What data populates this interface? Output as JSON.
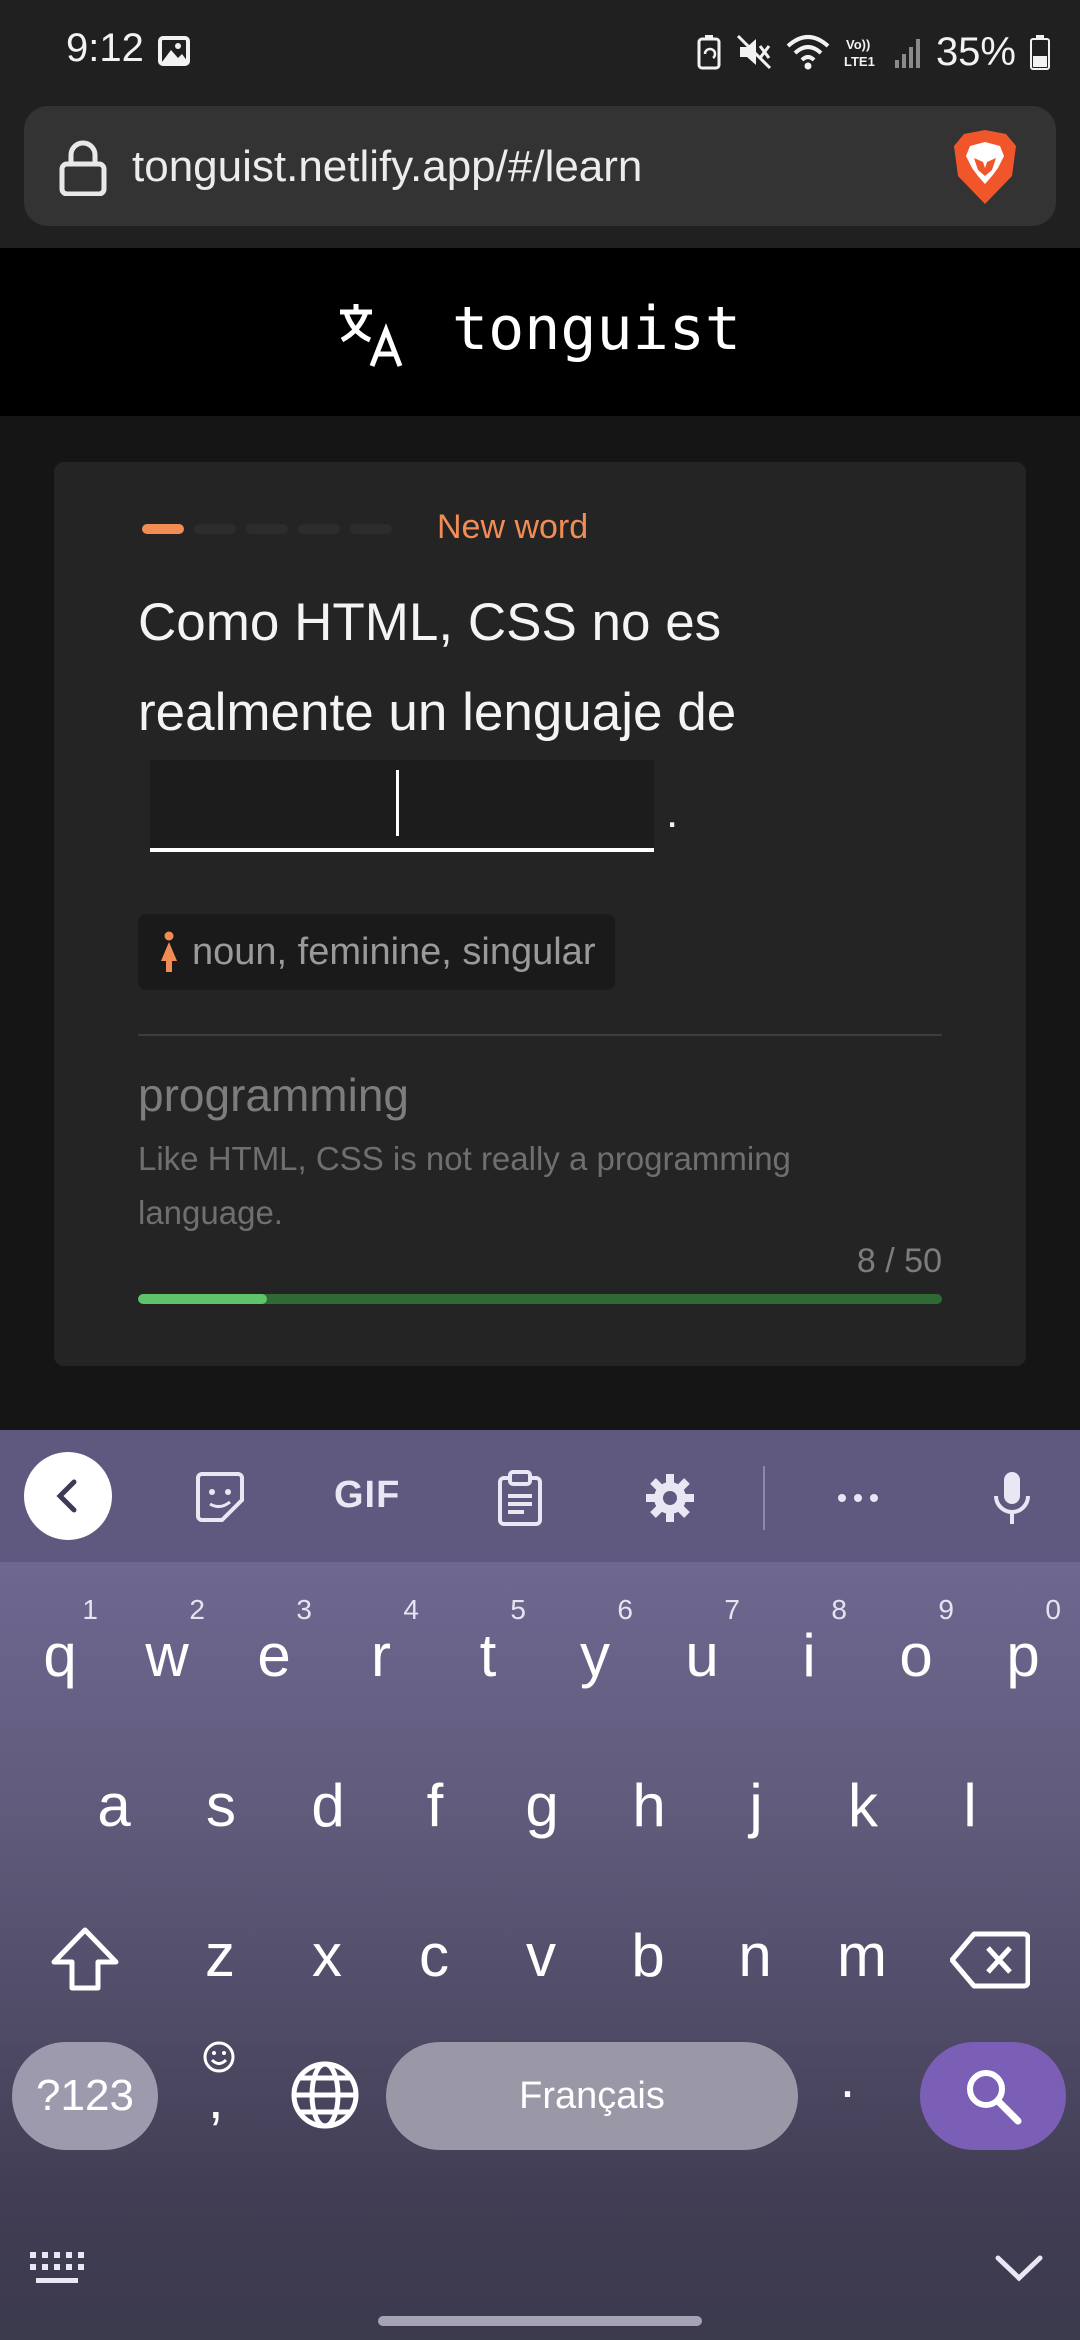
{
  "status_bar": {
    "time": "9:12",
    "battery": "35%",
    "network_label": "Vo) LTE1"
  },
  "browser": {
    "url": "tonguist.netlify.app/#/learn"
  },
  "app": {
    "title": "tonguist"
  },
  "card": {
    "status_label": "New word",
    "streak": {
      "total": 5,
      "filled": 1
    },
    "sentence": "Como HTML, CSS no es realmente un lenguaje de",
    "sentence_end": ".",
    "answer_value": "",
    "grammar": "noun, feminine, singular",
    "translation_word": "programming",
    "translation_sentence": "Like HTML, CSS is not really a programming language.",
    "progress": {
      "current": "8",
      "separator": "/",
      "total": "50",
      "fraction": 0.16
    }
  },
  "keyboard": {
    "toolbar": [
      "back-arrow-icon",
      "sticker-icon",
      "GIF",
      "clipboard-icon",
      "gear-icon",
      "more-icon",
      "microphone-icon"
    ],
    "gif_label": "GIF",
    "row1": [
      {
        "key": "q",
        "hint": "1"
      },
      {
        "key": "w",
        "hint": "2"
      },
      {
        "key": "e",
        "hint": "3"
      },
      {
        "key": "r",
        "hint": "4"
      },
      {
        "key": "t",
        "hint": "5"
      },
      {
        "key": "y",
        "hint": "6"
      },
      {
        "key": "u",
        "hint": "7"
      },
      {
        "key": "i",
        "hint": "8"
      },
      {
        "key": "o",
        "hint": "9"
      },
      {
        "key": "p",
        "hint": "0"
      }
    ],
    "row2": [
      "a",
      "s",
      "d",
      "f",
      "g",
      "h",
      "j",
      "k",
      "l"
    ],
    "row3": [
      "z",
      "x",
      "c",
      "v",
      "b",
      "n",
      "m"
    ],
    "symbols_label": "?123",
    "comma_label": ",",
    "space_label": "Français",
    "period_label": "."
  },
  "colors": {
    "accent": "#f28c55",
    "progress_fill": "#5fc36a",
    "progress_track": "#2f6a34",
    "search_key": "#7b5fb6"
  }
}
